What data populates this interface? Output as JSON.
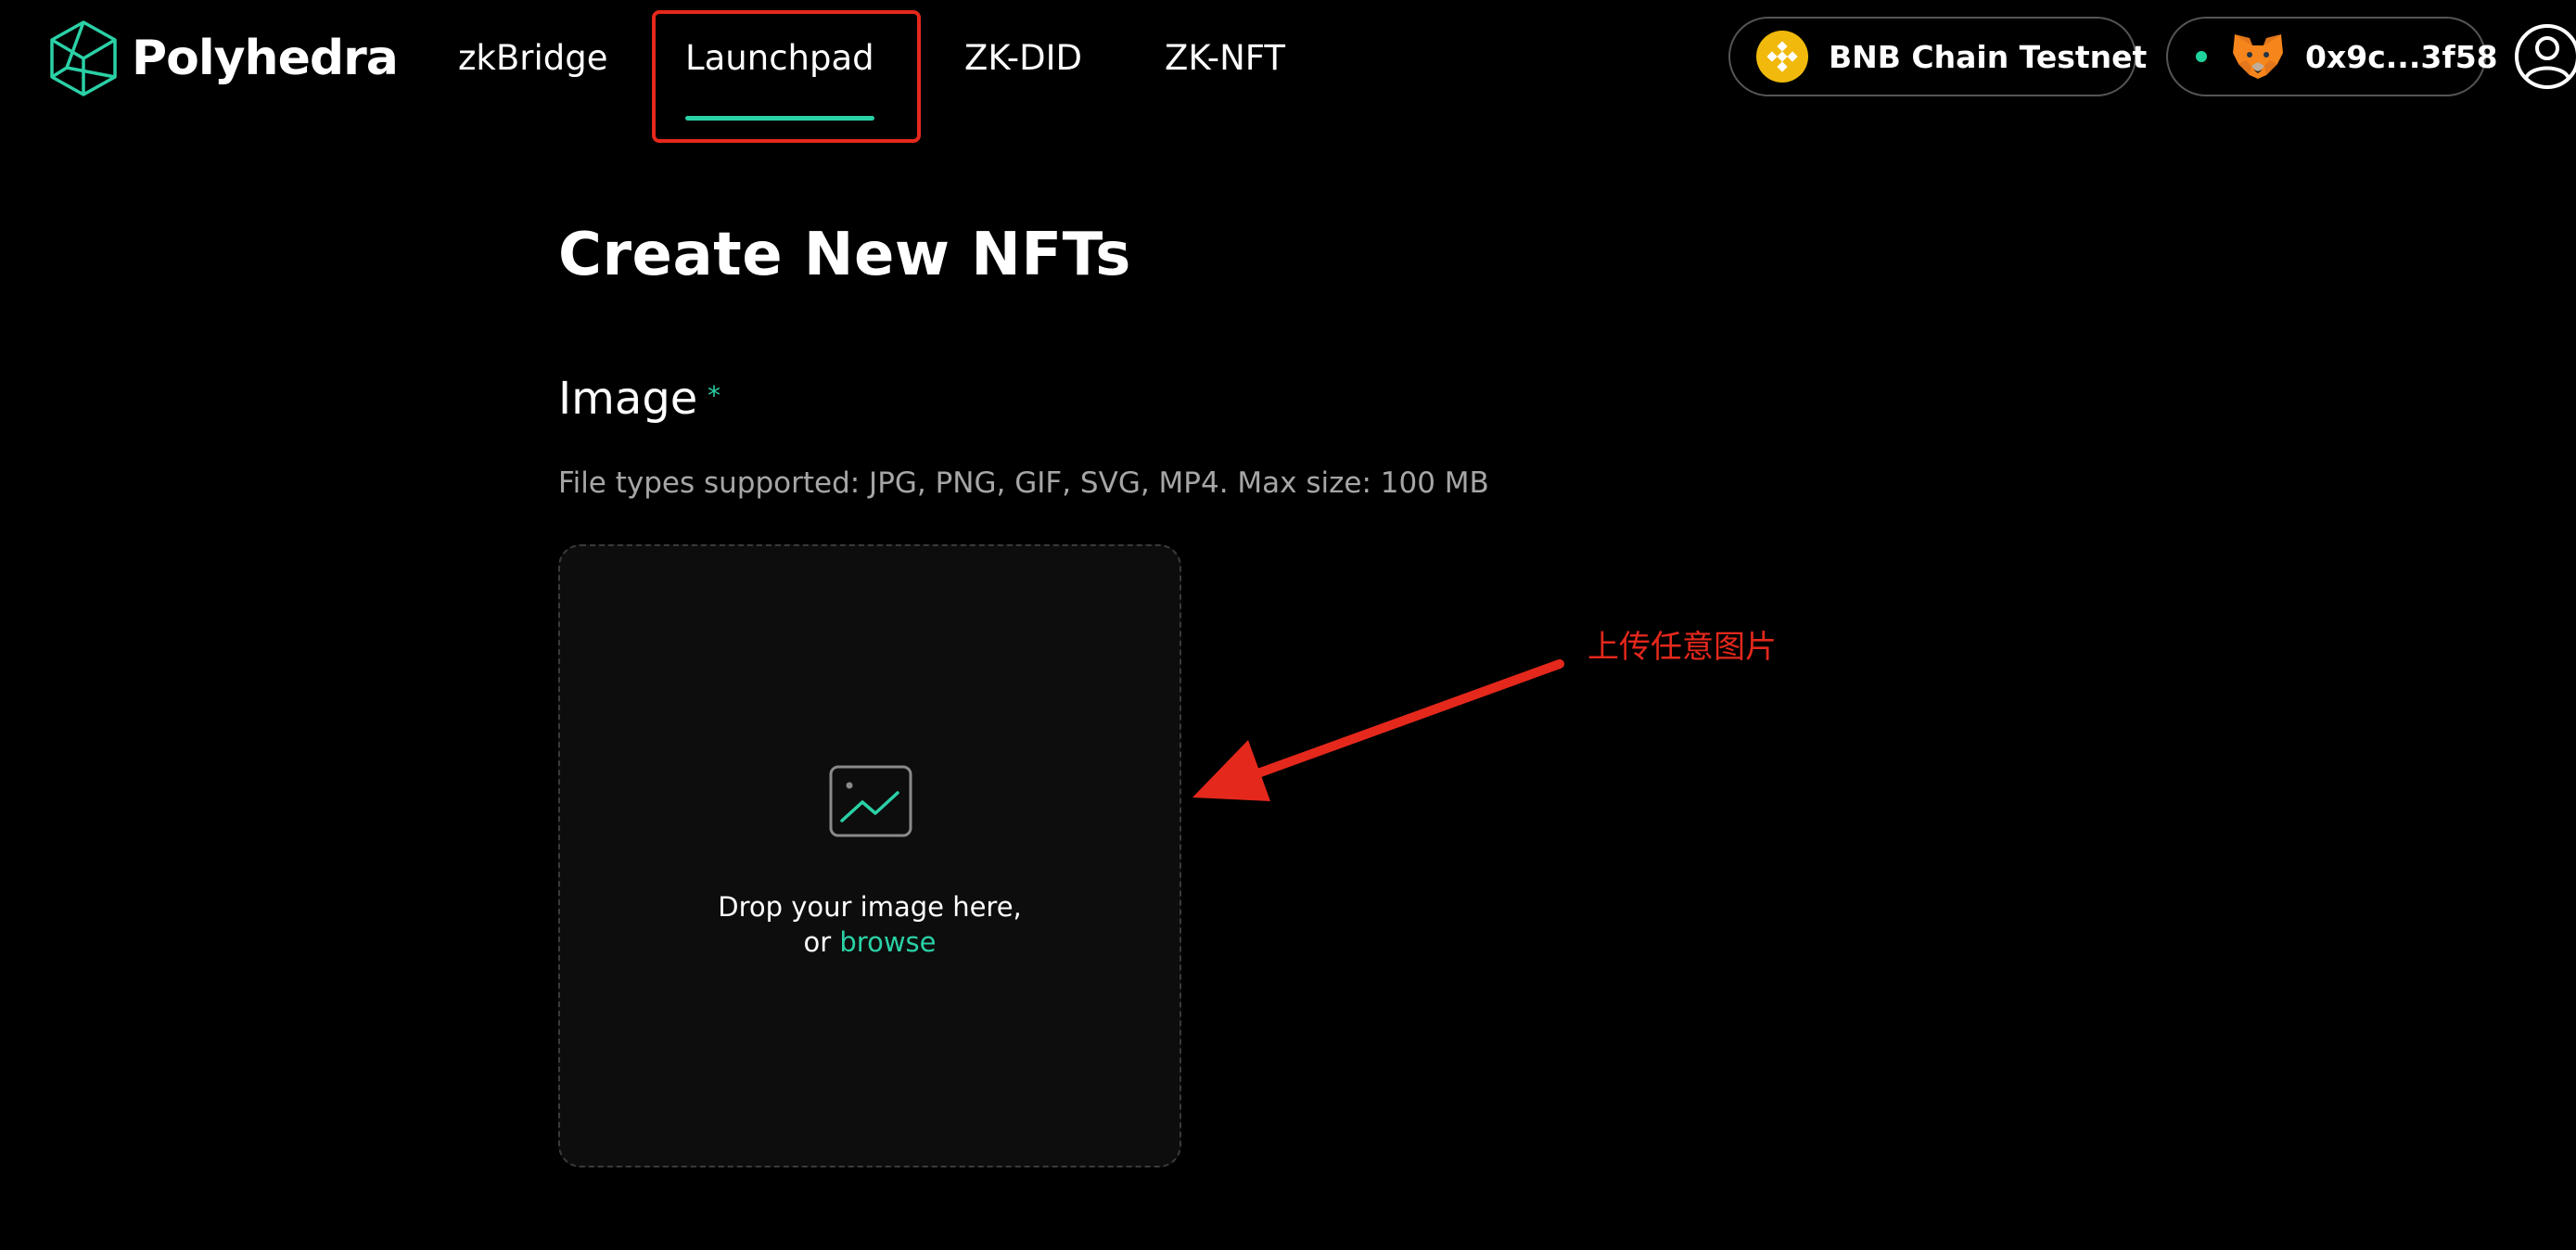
{
  "header": {
    "brand": "Polyhedra",
    "nav": [
      {
        "label": "zkBridge",
        "active": false
      },
      {
        "label": "Launchpad",
        "active": true
      },
      {
        "label": "ZK-DID",
        "active": false
      },
      {
        "label": "ZK-NFT",
        "active": false
      }
    ],
    "network": {
      "label": "BNB Chain Testnet",
      "icon": "bnb-chain-icon"
    },
    "wallet": {
      "address": "0x9c...3f58",
      "icon": "metamask-fox-icon",
      "status": "connected"
    },
    "account_icon": "user-icon"
  },
  "main": {
    "title": "Create New NFTs",
    "image_field": {
      "label": "Image",
      "required_mark": "*",
      "helper": "File types supported: JPG, PNG, GIF, SVG, MP4. Max size: 100 MB",
      "dropzone": {
        "line1": "Drop your image here,",
        "line2_prefix": "or",
        "browse_label": "browse",
        "icon": "image-placeholder-icon"
      }
    }
  },
  "annotation": {
    "text": "上传任意图片"
  },
  "colors": {
    "accent": "#2ad1a6",
    "background": "#000000",
    "annotation": "#e5281c",
    "bnb": "#f0b90b",
    "status": "#1fd49c"
  }
}
